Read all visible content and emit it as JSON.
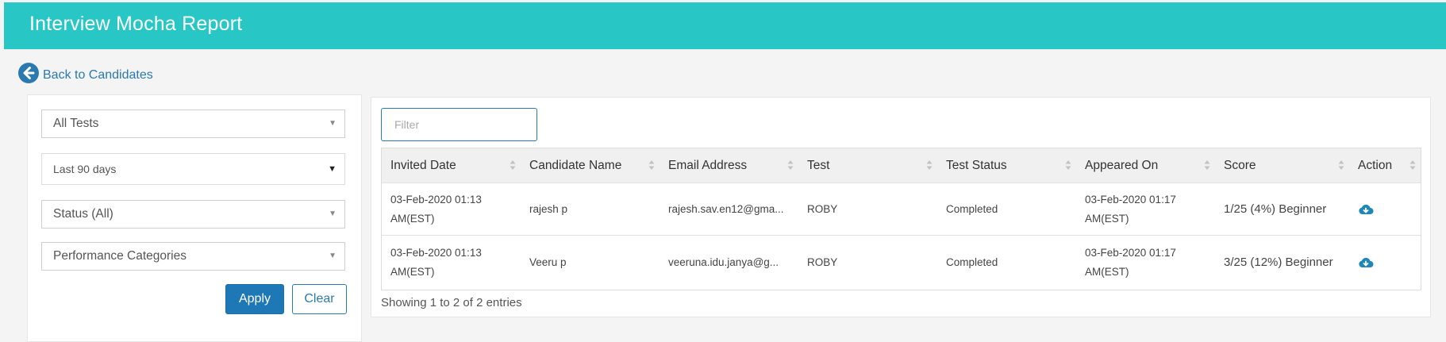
{
  "header": {
    "title": "Interview Mocha Report",
    "bg_color": "#29c6c6"
  },
  "back": {
    "label": "Back to Candidates",
    "icon": "arrow-left-circle-icon"
  },
  "filters": {
    "tests": "All Tests",
    "date_range": "Last 90 days",
    "status": "Status (All)",
    "performance": "Performance Categories",
    "apply_label": "Apply",
    "clear_label": "Clear"
  },
  "table": {
    "filter_placeholder": "Filter",
    "columns": [
      "Invited Date",
      "Candidate Name",
      "Email Address",
      "Test",
      "Test Status",
      "Appeared On",
      "Score",
      "Action"
    ],
    "rows": [
      {
        "invited": "03-Feb-2020 01:13 AM(EST)",
        "name": "rajesh p",
        "email": "rajesh.sav.en12@gma...",
        "test": "ROBY",
        "status": "Completed",
        "appeared": "03-Feb-2020 01:17 AM(EST)",
        "score": "1/25 (4%) Beginner",
        "action_icon": "cloud-download-icon"
      },
      {
        "invited": "03-Feb-2020 01:13 AM(EST)",
        "name": "Veeru p",
        "email": "veeruna.idu.janya@g...",
        "test": "ROBY",
        "status": "Completed",
        "appeared": "03-Feb-2020 01:17 AM(EST)",
        "score": "3/25 (12%) Beginner",
        "action_icon": "cloud-download-icon"
      }
    ],
    "summary": "Showing 1 to 2 of 2 entries"
  },
  "colors": {
    "accent": "#2a7ab0",
    "button": "#1e78b6"
  }
}
